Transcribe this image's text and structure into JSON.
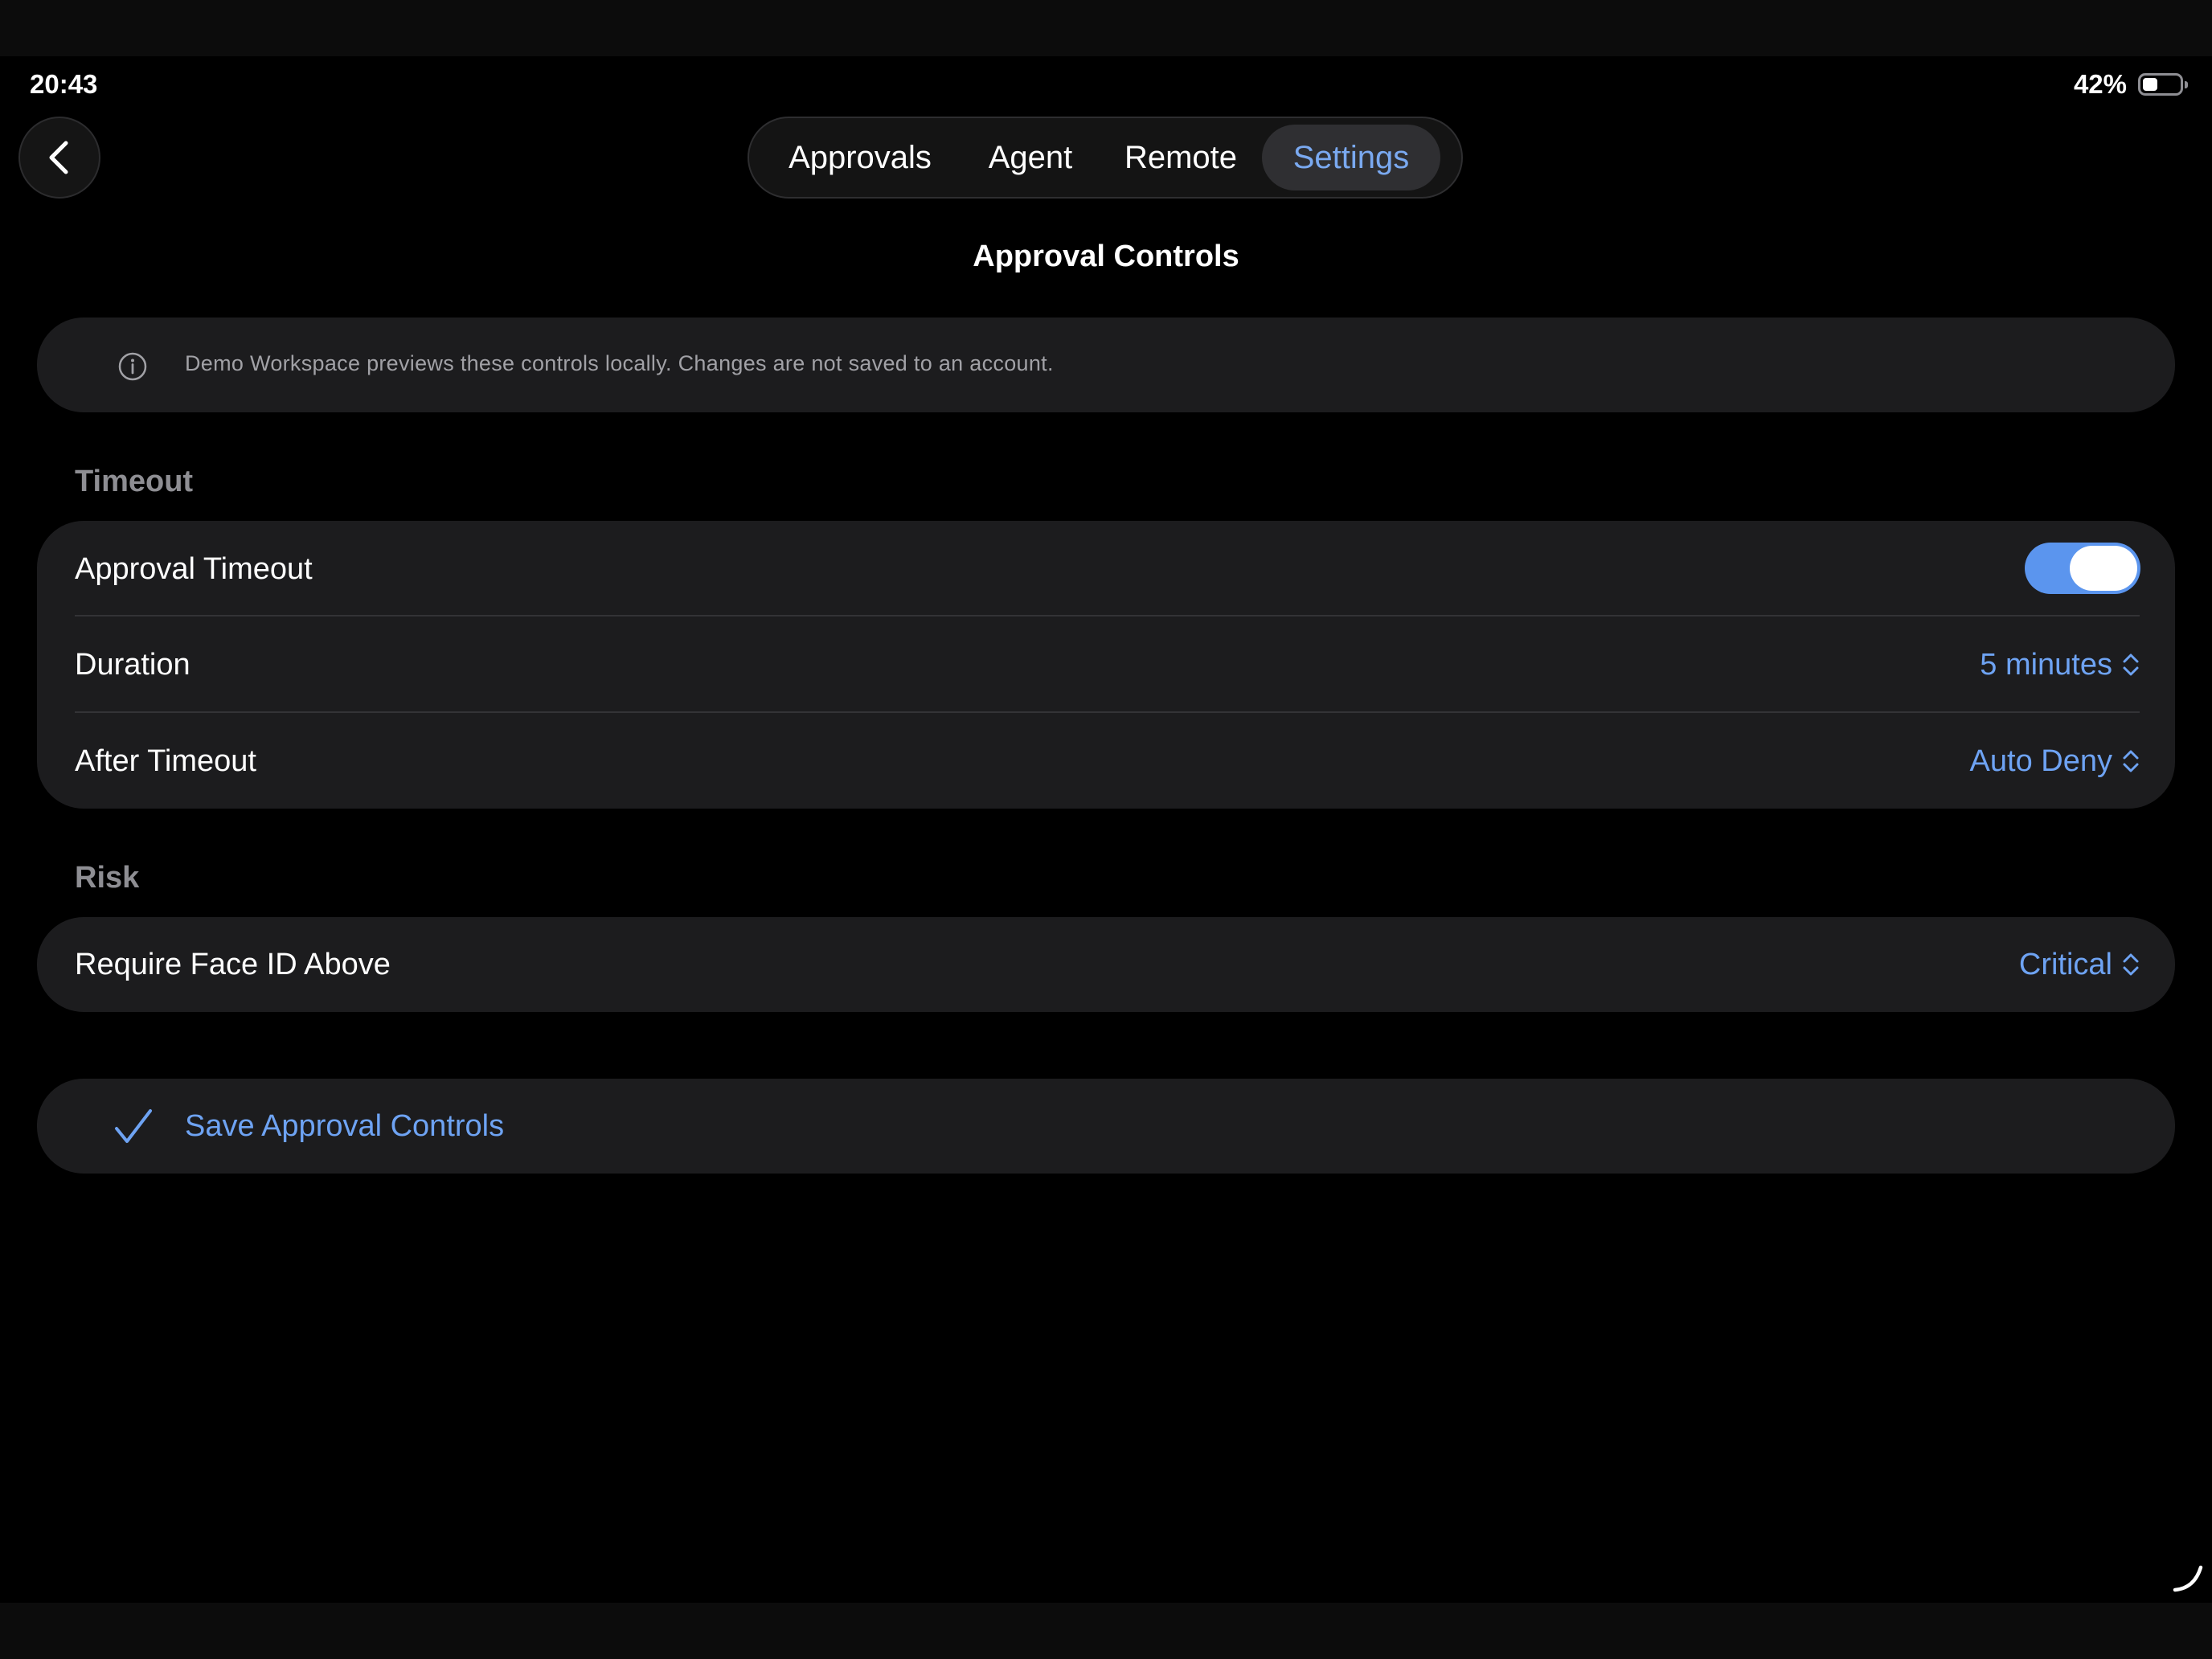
{
  "status_bar": {
    "time": "20:43",
    "battery_percent_label": "42%",
    "battery_level": 0.42
  },
  "nav": {
    "back_icon": "chevron-left-icon",
    "tabs": [
      {
        "label": "Approvals",
        "active": false
      },
      {
        "label": "Agent",
        "active": false
      },
      {
        "label": "Remote",
        "active": false
      },
      {
        "label": "Settings",
        "active": true
      }
    ]
  },
  "page": {
    "title": "Approval Controls"
  },
  "info_banner": {
    "icon": "info-icon",
    "text": "Demo Workspace previews these controls locally. Changes are not saved to an account."
  },
  "sections": {
    "timeout": {
      "header": "Timeout",
      "approval_timeout": {
        "label": "Approval Timeout",
        "enabled": true
      },
      "duration": {
        "label": "Duration",
        "value": "5 minutes"
      },
      "after_timeout": {
        "label": "After Timeout",
        "value": "Auto Deny"
      }
    },
    "risk": {
      "header": "Risk",
      "require_face_id": {
        "label": "Require Face ID Above",
        "value": "Critical"
      }
    }
  },
  "save": {
    "icon": "checkmark-icon",
    "label": "Save Approval Controls"
  },
  "colors": {
    "accent": "#6ea3f3",
    "toggle_on": "#5b95ee",
    "card_bg": "#1c1c1e",
    "background": "#000000"
  }
}
